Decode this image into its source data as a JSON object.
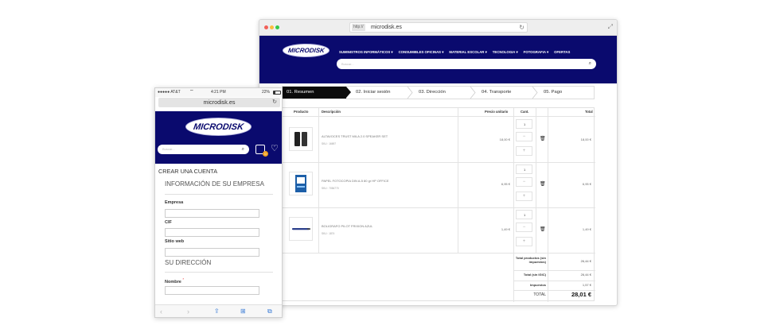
{
  "desktop": {
    "url_protocol": "http://",
    "url_host": "microdisk.es",
    "logo_text": "MICRODISK",
    "nav": [
      "SUMINISTROS INFORMÁTICOS ▾",
      "CONSUMIBLES OFICINAS ▾",
      "MATERIAL ESCOLAR ▾",
      "TECNOLOGIA ▾",
      "FOTOGRAFIA ▾",
      "OFERTAS"
    ],
    "search_placeholder": "Buscar...",
    "steps": [
      "01. Resumen",
      "02. Iniciar sesión",
      "03. Dirección",
      "04. Transporte",
      "05. Pago"
    ],
    "table_headers": {
      "product": "Producto",
      "description": "Descripción",
      "unit_price": "Precio unitario",
      "qty": "Cant.",
      "total": "Total"
    },
    "items": [
      {
        "description": "ALTAVOCES TRUST MILA 2.0 SPEAKER SET",
        "sku": "SKU : 16697",
        "unit_price": "18,00 €",
        "qty": "1",
        "total": "18,00 €"
      },
      {
        "description": "PAPEL FOTOCOPIA DIN A-5 80 gr HP OFFICE",
        "sku": "SKU : 7084770",
        "unit_price": "6,95 €",
        "qty": "1",
        "total": "6,95 €"
      },
      {
        "description": "BOLIGRAFO PILOT FRIXION AZUL",
        "sku": "SKU : 1874",
        "unit_price": "1,49 €",
        "qty": "1",
        "total": "1,49 €"
      }
    ],
    "qty_minus": "−",
    "qty_plus": "+",
    "totals": [
      {
        "label": "Total productos (sin impuestos)",
        "value": "26,44 €"
      },
      {
        "label": "Total (sin IGIC)",
        "value": "26,44 €"
      },
      {
        "label": "Impuestos",
        "value": "1,57 €"
      }
    ],
    "grand_total_label": "TOTAL",
    "grand_total_value": "28,01 €"
  },
  "phone": {
    "carrier": "●●●●● AT&T",
    "wifi": "⌔",
    "time": "4:21 PM",
    "battery": "22%",
    "url": "microdisk.es",
    "logo_text": "MICRODISK",
    "search_placeholder": "Buscar...",
    "cart_count": "0",
    "page_title": "CREAR UNA CUENTA",
    "section_company": "INFORMACIÓN DE SU EMPRESA",
    "field_company": "Empresa",
    "field_cif": "CIF",
    "field_website": "Sitio web",
    "section_address": "SU DIRECCIÓN",
    "field_name": "Nombre",
    "required_mark": "*"
  }
}
